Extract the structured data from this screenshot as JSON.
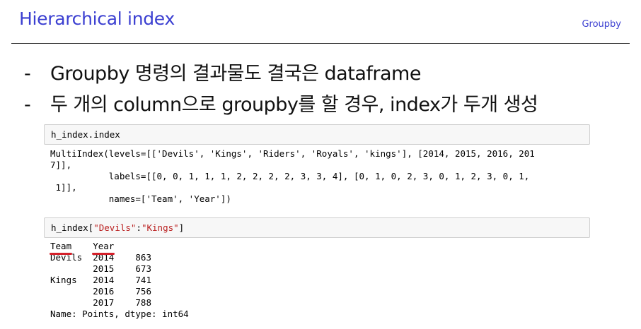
{
  "slide": {
    "title": "Hierarchical index",
    "section": "Groupby"
  },
  "bullets": [
    {
      "dash": "-",
      "text": "Groupby 명령의 결과물도 결국은 dataframe"
    },
    {
      "dash": "-",
      "text": "두 개의 column으로 groupby를 할 경우, index가 두개 생성"
    }
  ],
  "cell1": {
    "code": "h_index.index",
    "output": "MultiIndex(levels=[['Devils', 'Kings', 'Riders', 'Royals', 'kings'], [2014, 2015, 2016, 201\n7]],\n           labels=[[0, 0, 1, 1, 1, 2, 2, 2, 2, 3, 3, 4], [0, 1, 0, 2, 3, 0, 1, 2, 3, 0, 1,\n 1]],\n           names=['Team', 'Year'])"
  },
  "cell2": {
    "code_prefix": "h_index[",
    "code_str1": "\"Devils\"",
    "code_colon": ":",
    "code_str2": "\"Kings\"",
    "code_suffix": "]",
    "header_team": "Team",
    "header_year": "Year",
    "rows": "Devils  2014    863\n        2015    673\nKings   2014    741\n        2016    756\n        2017    788\nName: Points, dtype: int64"
  },
  "colors": {
    "title": "#3b3fd1",
    "string_literal": "#ba2121",
    "underline": "#d4202a"
  }
}
